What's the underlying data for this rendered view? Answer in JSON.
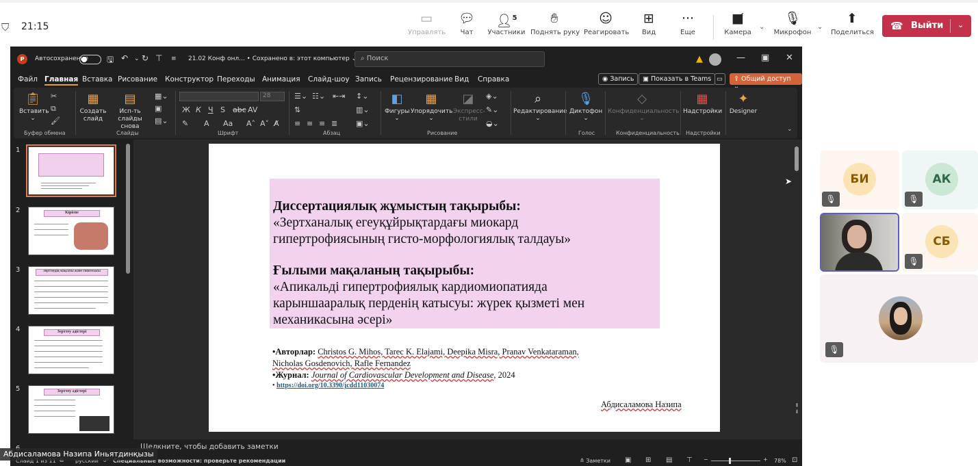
{
  "teams": {
    "time": "21:15",
    "controls": {
      "manage": "Управлять",
      "chat": "Чат",
      "participants": "Участники",
      "participants_count": "5",
      "raise_hand": "Поднять руку",
      "react": "Реагировать",
      "view": "Вид",
      "more": "Еще",
      "camera": "Камера",
      "mic": "Микрофон",
      "share": "Поделиться",
      "leave": "Выйти"
    }
  },
  "ppt": {
    "autosave": "Автосохранение",
    "doc_title": "21.02 Конф онл... • Сохранено в: этот компьютер ⌄",
    "search_placeholder": "Поиск",
    "tabs": [
      "Файл",
      "Главная",
      "Вставка",
      "Рисование",
      "Конструктор",
      "Переходы",
      "Анимация",
      "Слайд-шоу",
      "Запись",
      "Рецензирование",
      "Вид",
      "Справка"
    ],
    "record_btn": "Запись",
    "present_teams_btn": "Показать в Teams",
    "share_btn": "Общий доступ",
    "ribbon": {
      "paste": "Вставить",
      "new_slide": "Создать слайд",
      "reuse": "Исп-ть слайды снова",
      "font_size": "28",
      "shapes": "Фигуры",
      "arrange": "Упорядочить",
      "express": "Экспресс-стили",
      "editing": "Редактирование",
      "dictate": "Диктофон",
      "sensitivity": "Конфиденциальность",
      "addins": "Надстройки",
      "designer": "Designer",
      "groups": {
        "clipboard": "Буфер обмена",
        "slides": "Слайды",
        "font": "Шрифт",
        "paragraph": "Абзац",
        "drawing": "Рисование",
        "voice": "Голос",
        "sensitivity": "Конфиденциальность",
        "addins": "Надстройки"
      }
    },
    "thumb_numbers": [
      "1",
      "2",
      "3",
      "4",
      "5",
      "6"
    ],
    "thumb_titles": [
      "",
      "Кіріспе",
      "Зерттеудің мақсаты және гипотезасы",
      "Зерттеу әдістері",
      "Зерттеу әдістері"
    ],
    "slide": {
      "h1": "Диссертациялық жұмыстың тақырыбы:",
      "t1a": "«Зертханалық егеуқұйрықтардағы миокард",
      "t1b": "гипертрофиясының гисто-морфологиялық талдауы»",
      "h2": "Ғылыми мақаланың тақырыбы:",
      "t2a": "«Апикальді гипертрофиялық кардиомиопатияда",
      "t2b": "карыншааралық перденің катысуы: жүрек қызметі мен",
      "t2c": "механикасына әсері»",
      "authors_label": "•Авторлар:",
      "authors_1": "Christos G. Mihos, Tarec K. Elajami, Deepika Misra, Pranav Venkataraman,",
      "authors_2": "Nicholas Gosdenovich, Rafle Fernandez",
      "journal_label": "•Журнал:",
      "journal": "Journal of Cardiovascular Development and Disease",
      "journal_year": ", 2024",
      "doi_bullet": "•",
      "doi": "https://doi.org/10.3390/jcdd11030074",
      "presenter": "Абдисаламова Назипа"
    },
    "notes_placeholder": "Щелкните, чтобы добавить заметки",
    "status": {
      "slide": "Слайд 1 из 11",
      "lang": "русский",
      "accessibility": "Специальные возможности: проверьте рекомендации",
      "notes": "Заметки",
      "zoom": "78%"
    }
  },
  "presenter_name": "Абдисаламова Назипа Иньятдинқызы",
  "participants": [
    {
      "initials": "БИ",
      "color": "#fbe3b4",
      "text_color": "#8a5a00"
    },
    {
      "initials": "АК",
      "color": "#cbe8d5",
      "text_color": "#2d6b45"
    },
    {
      "initials": "СБ",
      "color": "#fbe3b4",
      "text_color": "#8a5a00"
    }
  ]
}
